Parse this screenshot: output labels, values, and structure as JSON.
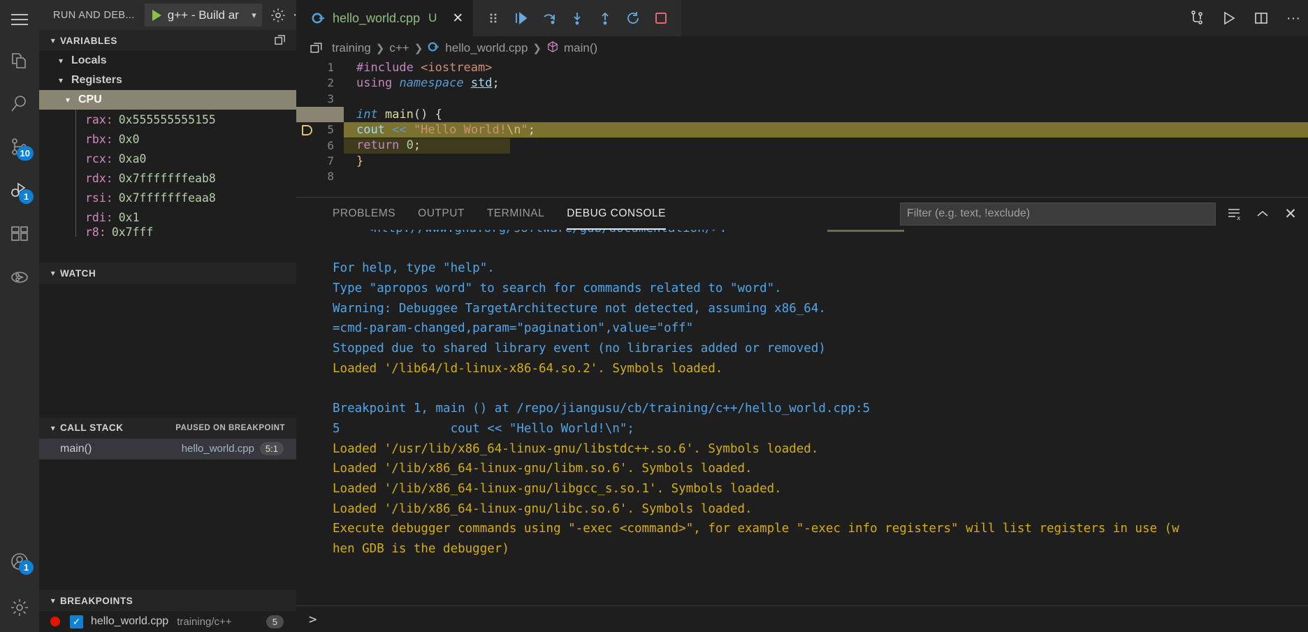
{
  "activitybar": {
    "items": [
      {
        "name": "menu-icon",
        "badge": null
      },
      {
        "name": "explorer-icon",
        "badge": null
      },
      {
        "name": "search-icon",
        "badge": null
      },
      {
        "name": "source-control-icon",
        "badge": "10"
      },
      {
        "name": "run-and-debug-icon",
        "badge": "1"
      },
      {
        "name": "extensions-icon",
        "badge": null
      },
      {
        "name": "testing-icon",
        "badge": null
      },
      {
        "name": "accounts-icon",
        "badge": "1"
      },
      {
        "name": "settings-gear-icon",
        "badge": null
      }
    ]
  },
  "sidebar": {
    "title": "RUN AND DEB...",
    "debug_config": "g++ - Build ar",
    "sections": {
      "variables": {
        "label": "VARIABLES",
        "nodes": [
          {
            "label": "Locals",
            "level": 1,
            "selected": false
          },
          {
            "label": "Registers",
            "level": 1,
            "selected": false
          },
          {
            "label": "CPU",
            "level": 2,
            "selected": true
          }
        ],
        "registers": [
          {
            "name": "rax:",
            "value": "0x555555555155"
          },
          {
            "name": "rbx:",
            "value": "0x0"
          },
          {
            "name": "rcx:",
            "value": "0xa0"
          },
          {
            "name": "rdx:",
            "value": "0x7fffffffeab8"
          },
          {
            "name": "rsi:",
            "value": "0x7fffffffeaa8"
          },
          {
            "name": "rdi:",
            "value": "0x1"
          }
        ]
      },
      "watch": {
        "label": "WATCH"
      },
      "callstack": {
        "label": "CALL STACK",
        "status": "PAUSED ON BREAKPOINT",
        "frames": [
          {
            "name": "main()",
            "file": "hello_world.cpp",
            "line": "5:1"
          }
        ]
      },
      "breakpoints": {
        "label": "BREAKPOINTS",
        "items": [
          {
            "file": "hello_world.cpp",
            "path": "training/c++",
            "line": "5",
            "checked": true
          }
        ]
      }
    }
  },
  "editor": {
    "tab": {
      "filename": "hello_world.cpp",
      "modified_mark": "U"
    },
    "breadcrumbs": [
      "training",
      "c++",
      "hello_world.cpp",
      "main()"
    ],
    "code_lines": [
      {
        "num": "1",
        "text": "#include <iostream>"
      },
      {
        "num": "2",
        "text": "using namespace std;"
      },
      {
        "num": "3",
        "text": ""
      },
      {
        "num": "4",
        "text": "int main() {"
      },
      {
        "num": "5",
        "text": "    cout << \"Hello World!\\n\";"
      },
      {
        "num": "6",
        "text": "    return 0;"
      },
      {
        "num": "7",
        "text": "}"
      },
      {
        "num": "8",
        "text": ""
      }
    ],
    "breakpoint_line": "5",
    "highlighted_line": "5"
  },
  "panel": {
    "tabs": [
      {
        "label": "PROBLEMS",
        "active": false
      },
      {
        "label": "OUTPUT",
        "active": false
      },
      {
        "label": "TERMINAL",
        "active": false
      },
      {
        "label": "DEBUG CONSOLE",
        "active": true
      }
    ],
    "filter_placeholder": "Filter (e.g. text, !exclude)",
    "filter_value": "",
    "console_lines": [
      {
        "text": "<http://www.gnu.org/software/gdb/documentation/>.",
        "color": "blue",
        "indent": 3
      },
      {
        "text": "",
        "color": "blue",
        "indent": 0
      },
      {
        "text": "For help, type \"help\".",
        "color": "blue",
        "indent": 0
      },
      {
        "text": "Type \"apropos word\" to search for commands related to \"word\".",
        "color": "blue",
        "indent": 0
      },
      {
        "text": "Warning: Debuggee TargetArchitecture not detected, assuming x86_64.",
        "color": "blue",
        "indent": 0
      },
      {
        "text": "=cmd-param-changed,param=\"pagination\",value=\"off\"",
        "color": "blue",
        "indent": 0
      },
      {
        "text": "Stopped due to shared library event (no libraries added or removed)",
        "color": "blue",
        "indent": 0
      },
      {
        "text": "Loaded '/lib64/ld-linux-x86-64.so.2'. Symbols loaded.",
        "color": "yellow",
        "indent": 0
      },
      {
        "text": "",
        "color": "blue",
        "indent": 0
      },
      {
        "text": "Breakpoint 1, main () at /repo/jiangusu/cb/training/c++/hello_world.cpp:5",
        "color": "blue",
        "indent": 0
      },
      {
        "text": "5               cout << \"Hello World!\\n\";",
        "color": "blue",
        "indent": 0
      },
      {
        "text": "Loaded '/usr/lib/x86_64-linux-gnu/libstdc++.so.6'. Symbols loaded.",
        "color": "yellow",
        "indent": 0
      },
      {
        "text": "Loaded '/lib/x86_64-linux-gnu/libm.so.6'. Symbols loaded.",
        "color": "yellow",
        "indent": 0
      },
      {
        "text": "Loaded '/lib/x86_64-linux-gnu/libgcc_s.so.1'. Symbols loaded.",
        "color": "yellow",
        "indent": 0
      },
      {
        "text": "Loaded '/lib/x86_64-linux-gnu/libc.so.6'. Symbols loaded.",
        "color": "yellow",
        "indent": 0
      },
      {
        "text": "Execute debugger commands using \"-exec <command>\", for example \"-exec info registers\" will list registers in use (w",
        "color": "yellow",
        "indent": 0
      },
      {
        "text": "hen GDB is the debugger)",
        "color": "yellow",
        "indent": 0
      }
    ],
    "prompt": ">"
  },
  "colors": {
    "accent": "#0e80d6",
    "breakpoint_red": "#e51400",
    "play_green": "#8bc34a",
    "highlight": "#7a722e",
    "console_blue": "#4fa6ea",
    "console_yellow": "#d4af0a"
  }
}
